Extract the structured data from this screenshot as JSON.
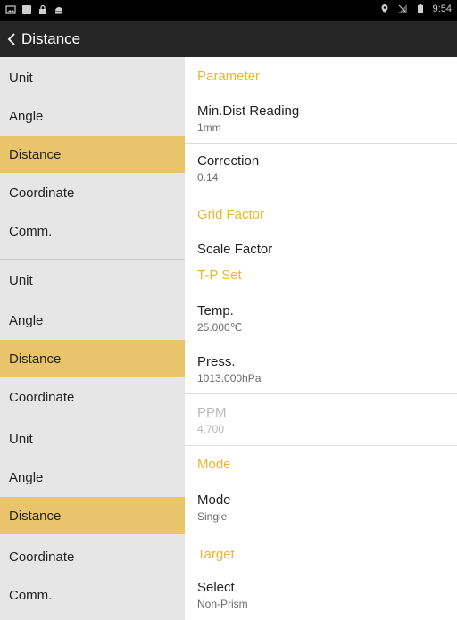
{
  "status_bar": {
    "time": "9:54",
    "left_icons": [
      "image-icon",
      "square-icon",
      "lock-icon",
      "android-icon"
    ],
    "right_icons": [
      "location-icon",
      "no-sim-icon",
      "battery-icon"
    ]
  },
  "app_bar": {
    "title": "Distance",
    "back_label": "<"
  },
  "nav_groups": [
    [
      {
        "label": "Unit",
        "active": false
      },
      {
        "label": "Angle",
        "active": false
      },
      {
        "label": "Distance",
        "active": true
      },
      {
        "label": "Coordinate",
        "active": false
      },
      {
        "label": "Comm.",
        "active": false
      }
    ],
    [
      {
        "label": "Unit",
        "active": false
      },
      {
        "label": "Angle",
        "active": false
      },
      {
        "label": "Distance",
        "active": true
      },
      {
        "label": "Coordinate",
        "active": false
      }
    ],
    [
      {
        "label": "Unit",
        "active": false
      },
      {
        "label": "Angle",
        "active": false
      },
      {
        "label": "Distance",
        "active": true
      },
      {
        "label": "Coordinate",
        "active": false
      },
      {
        "label": "Comm.",
        "active": false
      }
    ]
  ],
  "settings": {
    "parameter": {
      "title": "Parameter",
      "min_dist": {
        "name": "Min.Dist Reading",
        "value": "1mm"
      },
      "correction": {
        "name": "Correction",
        "value": "0.14"
      }
    },
    "grid_factor": {
      "title": "Grid Factor",
      "scale": {
        "name": "Scale Factor"
      }
    },
    "tp_set": {
      "title": "T-P Set",
      "temp": {
        "name": "Temp.",
        "value": "25.000℃"
      },
      "press": {
        "name": "Press.",
        "value": "1013.000hPa"
      },
      "ppm": {
        "name": "PPM",
        "value": "4.700"
      }
    },
    "mode": {
      "title": "Mode",
      "mode": {
        "name": "Mode",
        "value": "Single"
      }
    },
    "target": {
      "title": "Target",
      "select": {
        "name": "Select",
        "value": "Non-Prism"
      }
    }
  },
  "colors": {
    "accent": "#e8b634",
    "active_bg": "#e9c46a",
    "nav_bg": "#e6e6e6",
    "app_bar": "#262626"
  }
}
